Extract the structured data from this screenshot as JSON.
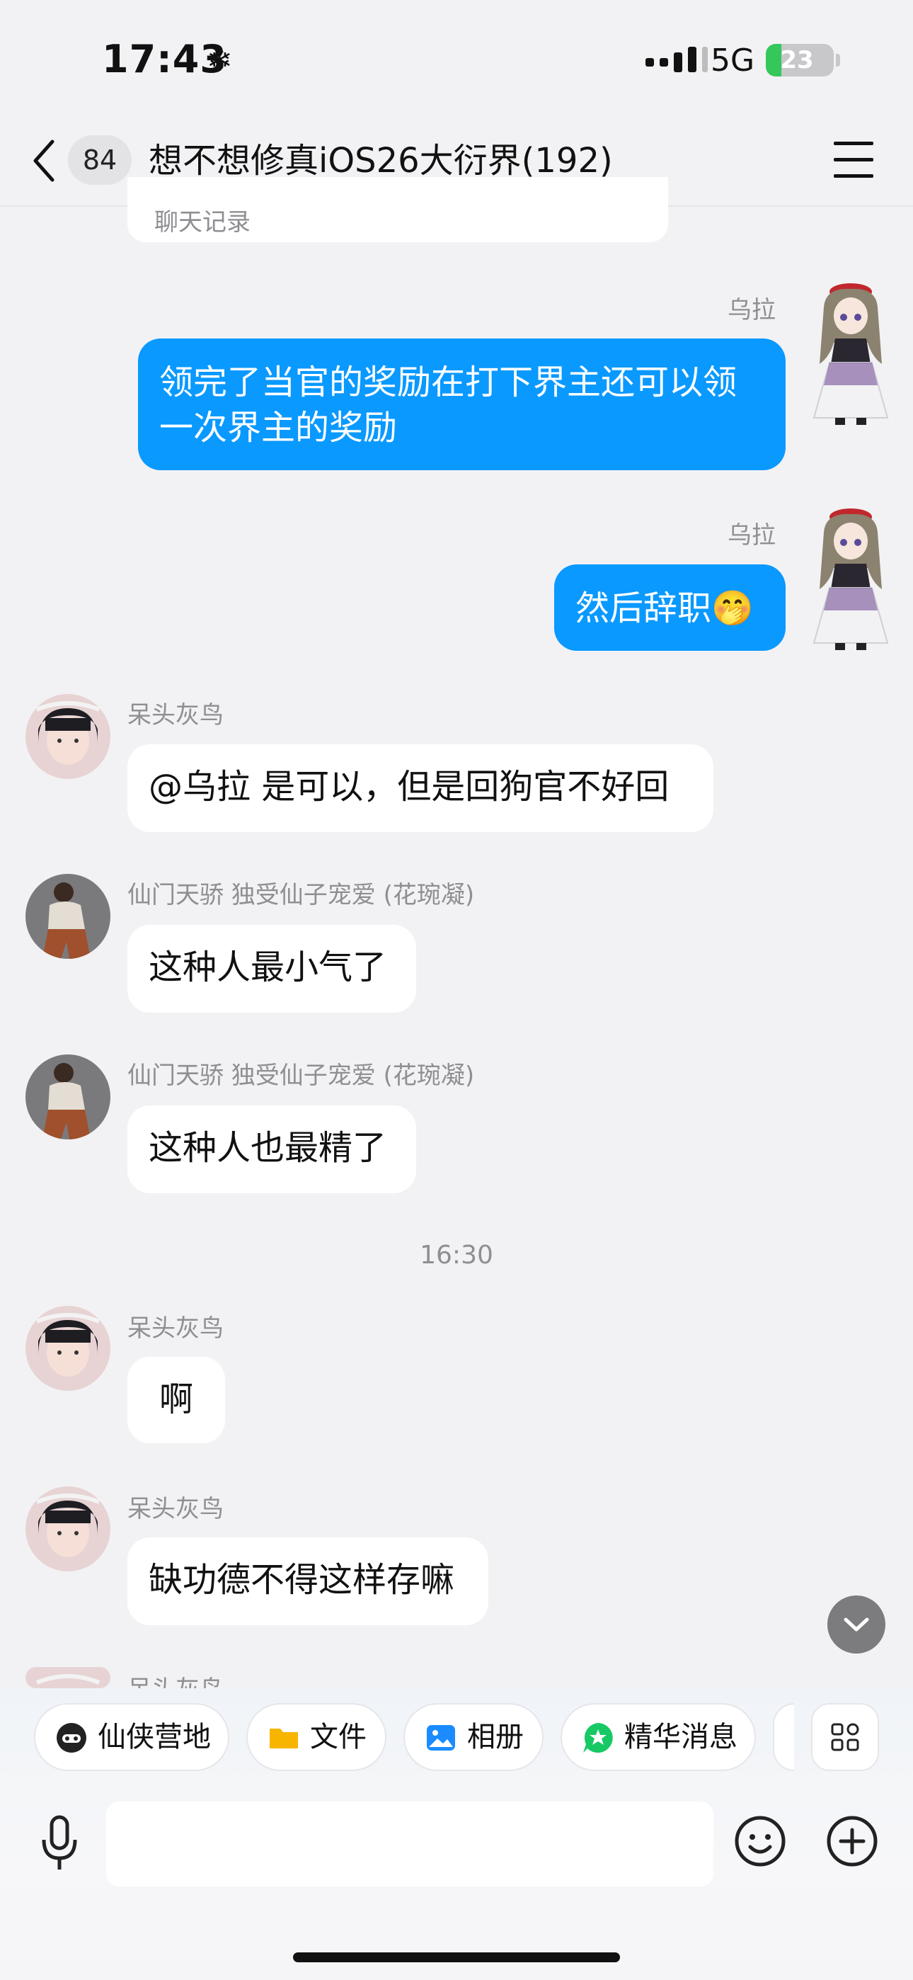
{
  "status_bar": {
    "time": "17:43",
    "network": "5G",
    "battery": "23",
    "battery_level": 0.23
  },
  "nav": {
    "back_count": "84",
    "title": "想不想修真iOS26大衍界(192)"
  },
  "previous_card": {
    "label": "聊天记录"
  },
  "messages": [
    {
      "side": "out",
      "sender": "乌拉",
      "text": "领完了当官的奖励在打下界主还可以领一次界主的奖励"
    },
    {
      "side": "out",
      "sender": "乌拉",
      "text": "然后辞职🤭"
    },
    {
      "side": "in",
      "sender": "呆头灰鸟",
      "text": "@乌拉 是可以，但是回狗官不好回"
    },
    {
      "side": "in",
      "sender": "仙门天骄 独受仙子宠爱 (花琬凝)",
      "text": "这种人最小气了"
    },
    {
      "side": "in",
      "sender": "仙门天骄 独受仙子宠爱 (花琬凝)",
      "text": "这种人也最精了"
    },
    {
      "side": "in",
      "sender": "呆头灰鸟",
      "text": "啊"
    },
    {
      "side": "in",
      "sender": "呆头灰鸟",
      "text": "缺功德不得这样存嘛"
    },
    {
      "side": "in",
      "sender": "呆头灰鸟",
      "text": ""
    }
  ],
  "time_separator": "16:30",
  "toolbar": {
    "chips": [
      {
        "label": "仙侠营地",
        "icon": "game-icon"
      },
      {
        "label": "文件",
        "icon": "folder-icon"
      },
      {
        "label": "相册",
        "icon": "photo-icon"
      },
      {
        "label": "精华消息",
        "icon": "star-icon"
      }
    ]
  },
  "colors": {
    "outgoing_bubble": "#0a99ff",
    "background": "#f2f2f4",
    "battery_green": "#34c759"
  }
}
